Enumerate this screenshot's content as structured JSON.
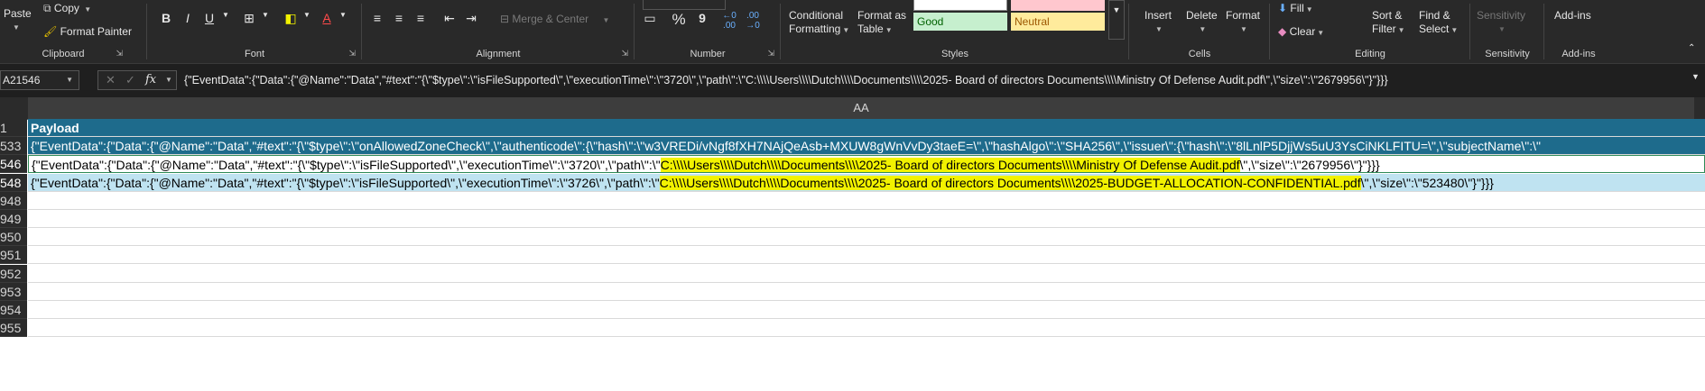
{
  "ribbon": {
    "clipboard": {
      "paste": "Paste",
      "copy": "Copy",
      "format_painter": "Format Painter",
      "label": "Clipboard"
    },
    "font": {
      "label": "Font",
      "bold": "B",
      "italic": "I",
      "underline": "U"
    },
    "alignment": {
      "label": "Alignment",
      "merge_center": "Merge & Center"
    },
    "number": {
      "label": "Number",
      "percent": "%",
      "comma": "9"
    },
    "styles": {
      "label": "Styles",
      "conditional_formatting": "Conditional\nFormatting",
      "format_as_table": "Format as\nTable",
      "good": "Good",
      "neutral": "Neutral"
    },
    "cells": {
      "label": "Cells",
      "insert": "Insert",
      "delete": "Delete",
      "format": "Format"
    },
    "editing": {
      "label": "Editing",
      "fill": "Fill",
      "clear": "Clear",
      "sort_filter": "Sort &\nFilter",
      "find_select": "Find &\nSelect"
    },
    "sensitivity": {
      "label": "Sensitivity",
      "button": "Sensitivity"
    },
    "addins": {
      "label": "Add-ins",
      "button": "Add-ins"
    }
  },
  "formula_bar": {
    "name_box": "A21546",
    "fx": "fx",
    "formula": "{\"EventData\":{\"Data\":{\"@Name\":\"Data\",\"#text\":\"{\\\"$type\\\":\\\"isFileSupported\\\",\\\"executionTime\\\":\\\"3720\\\",\\\"path\\\":\\\"C:\\\\\\\\Users\\\\\\\\Dutch\\\\\\\\Documents\\\\\\\\2025- Board of directors Documents\\\\\\\\Ministry Of Defense Audit.pdf\\\",\\\"size\\\":\\\"2679956\\\"}\"}}}"
  },
  "grid": {
    "column_header": "AA",
    "rows": [
      {
        "num": "1",
        "pre": "Payload",
        "hl": "",
        "post": "",
        "style": "header"
      },
      {
        "num": "533",
        "pre": "{\"EventData\":{\"Data\":{\"@Name\":\"Data\",\"#text\":\"{\\\"$type\\\":\\\"onAllowedZoneCheck\\\",\\\"authenticode\\\":{\\\"hash\\\":\\\"w3VREDi/vNgf8fXH7NAjQeAsb+MXUW8gWnVvDy3taeE=\\\",\\\"hashAlgo\\\":\\\"SHA256\\\",\\\"issuer\\\":{\\\"hash\\\":\\\"8lLnlP5DjjWs5uU3YsCiNKLFITU=\\\",\\\"subjectName\\\":\\\"",
        "hl": "",
        "post": "",
        "style": "blue"
      },
      {
        "num": "546",
        "pre": "{\"EventData\":{\"Data\":{\"@Name\":\"Data\",\"#text\":\"{\\\"$type\\\":\\\"isFileSupported\\\",\\\"executionTime\\\":\\\"3720\\\",\\\"path\\\":\\\"",
        "hl": "C:\\\\\\\\Users\\\\\\\\Dutch\\\\\\\\Documents\\\\\\\\2025- Board of directors Documents\\\\\\\\Ministry Of Defense Audit.pdf",
        "post": "\\\",\\\"size\\\":\\\"2679956\\\"}\"}}}",
        "style": "white"
      },
      {
        "num": "548",
        "pre": "{\"EventData\":{\"Data\":{\"@Name\":\"Data\",\"#text\":\"{\\\"$type\\\":\\\"isFileSupported\\\",\\\"executionTime\\\":\\\"3726\\\",\\\"path\\\":\\\"",
        "hl": "C:\\\\\\\\Users\\\\\\\\Dutch\\\\\\\\Documents\\\\\\\\2025- Board of directors Documents\\\\\\\\2025-BUDGET-ALLOCATION-CONFIDENTIAL.pdf",
        "post": "\\\",\\\"size\\\":\\\"523480\\\"}\"}}}",
        "style": "lightblue"
      },
      {
        "num": "948",
        "pre": "",
        "hl": "",
        "post": "",
        "style": "empty"
      },
      {
        "num": "949",
        "pre": "",
        "hl": "",
        "post": "",
        "style": "empty"
      },
      {
        "num": "950",
        "pre": "",
        "hl": "",
        "post": "",
        "style": "empty"
      },
      {
        "num": "951",
        "pre": "",
        "hl": "",
        "post": "",
        "style": "empty"
      },
      {
        "num": "952",
        "pre": "",
        "hl": "",
        "post": "",
        "style": "empty"
      },
      {
        "num": "953",
        "pre": "",
        "hl": "",
        "post": "",
        "style": "empty"
      },
      {
        "num": "954",
        "pre": "",
        "hl": "",
        "post": "",
        "style": "empty"
      },
      {
        "num": "955",
        "pre": "",
        "hl": "",
        "post": "",
        "style": "empty"
      }
    ]
  },
  "colors": {
    "header_bg": "#1e6b8c",
    "blue_row": "#1e6b8c",
    "lightblue_row": "#bfe3f1",
    "highlight": "#f2f200"
  }
}
